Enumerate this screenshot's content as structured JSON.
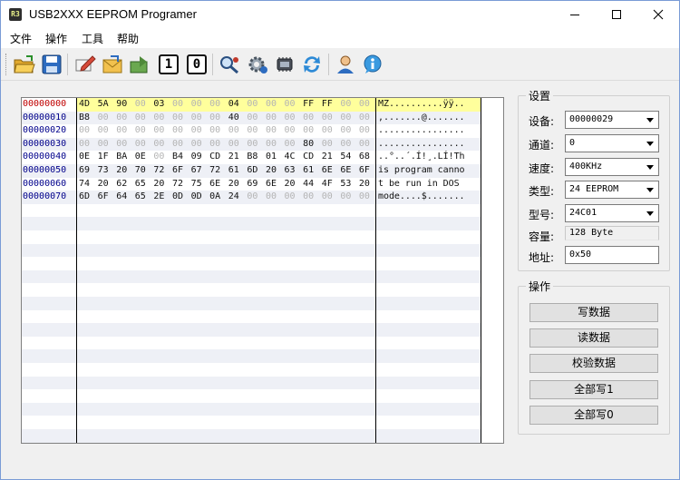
{
  "window": {
    "app_icon_text": "R3",
    "title": "USB2XXX EEPROM Programer"
  },
  "menu": [
    "文件",
    "操作",
    "工具",
    "帮助"
  ],
  "toolbar": {
    "icons": [
      "open-folder-icon",
      "save-icon",
      "edit-icon",
      "mail-icon",
      "import-icon",
      "digit-one-icon",
      "digit-zero-icon",
      "search-config-icon",
      "gear-icon",
      "device-icon",
      "refresh-icon",
      "user-icon",
      "info-icon"
    ],
    "digit_one": "1",
    "digit_zero": "0"
  },
  "hex": {
    "rows": [
      {
        "addr": "00000000",
        "bytes": [
          "4D",
          "5A",
          "90",
          "00",
          "03",
          "00",
          "00",
          "00",
          "04",
          "00",
          "00",
          "00",
          "FF",
          "FF",
          "00",
          "00"
        ],
        "ascii": "MZ..........ÿÿ.."
      },
      {
        "addr": "00000010",
        "bytes": [
          "B8",
          "00",
          "00",
          "00",
          "00",
          "00",
          "00",
          "00",
          "40",
          "00",
          "00",
          "00",
          "00",
          "00",
          "00",
          "00"
        ],
        "ascii": ",.......@......."
      },
      {
        "addr": "00000020",
        "bytes": [
          "00",
          "00",
          "00",
          "00",
          "00",
          "00",
          "00",
          "00",
          "00",
          "00",
          "00",
          "00",
          "00",
          "00",
          "00",
          "00"
        ],
        "ascii": "................"
      },
      {
        "addr": "00000030",
        "bytes": [
          "00",
          "00",
          "00",
          "00",
          "00",
          "00",
          "00",
          "00",
          "00",
          "00",
          "00",
          "00",
          "80",
          "00",
          "00",
          "00"
        ],
        "ascii": "................"
      },
      {
        "addr": "00000040",
        "bytes": [
          "0E",
          "1F",
          "BA",
          "0E",
          "00",
          "B4",
          "09",
          "CD",
          "21",
          "B8",
          "01",
          "4C",
          "CD",
          "21",
          "54",
          "68"
        ],
        "ascii": "..°..´.Í!¸.LÍ!Th"
      },
      {
        "addr": "00000050",
        "bytes": [
          "69",
          "73",
          "20",
          "70",
          "72",
          "6F",
          "67",
          "72",
          "61",
          "6D",
          "20",
          "63",
          "61",
          "6E",
          "6E",
          "6F"
        ],
        "ascii": "is program canno"
      },
      {
        "addr": "00000060",
        "bytes": [
          "74",
          "20",
          "62",
          "65",
          "20",
          "72",
          "75",
          "6E",
          "20",
          "69",
          "6E",
          "20",
          "44",
          "4F",
          "53",
          "20"
        ],
        "ascii": "t be run in DOS "
      },
      {
        "addr": "00000070",
        "bytes": [
          "6D",
          "6F",
          "64",
          "65",
          "2E",
          "0D",
          "0D",
          "0A",
          "24",
          "00",
          "00",
          "00",
          "00",
          "00",
          "00",
          "00"
        ],
        "ascii": "mode....$......."
      }
    ],
    "total_visible_rows": 26
  },
  "settings": {
    "title": "设置",
    "device_label": "设备:",
    "device_value": "00000029",
    "channel_label": "通道:",
    "channel_value": "0",
    "speed_label": "速度:",
    "speed_value": "400KHz",
    "type_label": "类型:",
    "type_value": "24 EEPROM",
    "model_label": "型号:",
    "model_value": "24C01",
    "capacity_label": "容量:",
    "capacity_value": "128 Byte",
    "address_label": "地址:",
    "address_value": "0x50"
  },
  "operations": {
    "title": "操作",
    "write": "写数据",
    "read": "读数据",
    "verify": "校验数据",
    "write_all_1": "全部写1",
    "write_all_0": "全部写0"
  }
}
